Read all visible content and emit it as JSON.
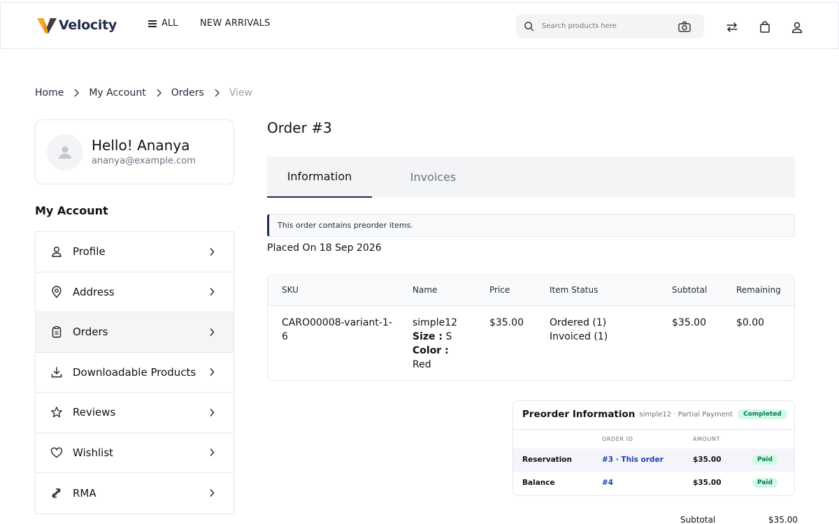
{
  "header": {
    "brand": "Velocity",
    "nav_all": "ALL",
    "nav_new_arrivals": "NEW ARRIVALS",
    "search_placeholder": "Search products here"
  },
  "breadcrumb": {
    "items": [
      "Home",
      "My Account",
      "Orders"
    ],
    "current": "View"
  },
  "profile": {
    "greeting": "Hello! Ananya",
    "email": "ananya@example.com"
  },
  "sidebar": {
    "title": "My Account",
    "items": [
      {
        "label": "Profile",
        "icon": "user-icon"
      },
      {
        "label": "Address",
        "icon": "location-pin-icon"
      },
      {
        "label": "Orders",
        "icon": "clipboard-icon",
        "active": true
      },
      {
        "label": "Downloadable Products",
        "icon": "download-icon"
      },
      {
        "label": "Reviews",
        "icon": "star-icon"
      },
      {
        "label": "Wishlist",
        "icon": "heart-icon"
      },
      {
        "label": "RMA",
        "icon": "return-arrows-icon"
      }
    ]
  },
  "order": {
    "title": "Order #3",
    "tabs": [
      "Information",
      "Invoices"
    ],
    "notice": "This order contains preorder items.",
    "placed_on": "Placed On 18 Sep 2026",
    "columns": [
      "SKU",
      "Name",
      "Price",
      "Item Status",
      "Subtotal",
      "Remaining"
    ],
    "item": {
      "sku": "CARO00008-variant-1-6",
      "name": "simple12",
      "size_label": "Size :",
      "size_value": "S",
      "color_label": "Color :",
      "color_value": "Red",
      "price": "$35.00",
      "status_ordered": "Ordered (1)",
      "status_invoiced": "Invoiced (1)",
      "subtotal": "$35.00",
      "remaining": "$0.00"
    }
  },
  "preorder": {
    "title": "Preorder Information",
    "subtitle": "simple12 · Partial Payment",
    "badge": "Completed",
    "columns": [
      "ORDER ID",
      "AMOUNT"
    ],
    "rows": [
      {
        "label": "Reservation",
        "order_id": "#3 · This order",
        "amount": "$35.00",
        "status": "Paid"
      },
      {
        "label": "Balance",
        "order_id": "#4",
        "amount": "$35.00",
        "status": "Paid"
      }
    ]
  },
  "summary": {
    "subtotal_label": "Subtotal",
    "subtotal_value": "$35.00"
  },
  "colors": {
    "brand_navy": "#1f2b4d",
    "logo_orange": "#f5a623",
    "paid_green": "#047857",
    "paid_bg": "#d1fae5",
    "link_blue": "#1e40af"
  }
}
